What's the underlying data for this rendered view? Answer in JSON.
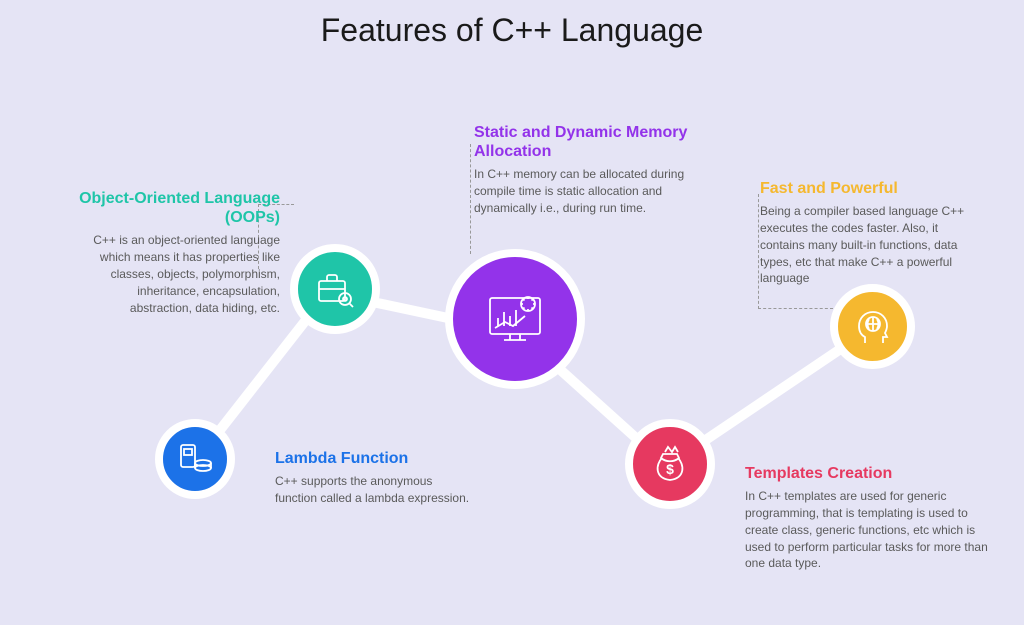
{
  "title": "Features of C++ Language",
  "features": {
    "oops": {
      "heading": "Object-Oriented Language (OOPs)",
      "desc": "C++ is an object-oriented language which means it has properties like classes, objects, polymorphism, inheritance, encapsulation, abstraction, data hiding, etc."
    },
    "lambda": {
      "heading": "Lambda Function",
      "desc": "C++ supports the anonymous function called a lambda expression."
    },
    "memory": {
      "heading": "Static and Dynamic Memory Allocation",
      "desc": "In C++ memory can be allocated during compile time is static allocation and dynamically i.e., during run time."
    },
    "fast": {
      "heading": "Fast and Powerful",
      "desc": "Being a compiler based language C++ executes the codes faster. Also, it contains many built-in functions, data types, etc that make C++ a powerful language"
    },
    "templates": {
      "heading": "Templates Creation",
      "desc": "In C++ templates are used for generic programming, that is templating is used to create class, generic functions, etc which is used to perform particular tasks for more than one data type."
    }
  }
}
